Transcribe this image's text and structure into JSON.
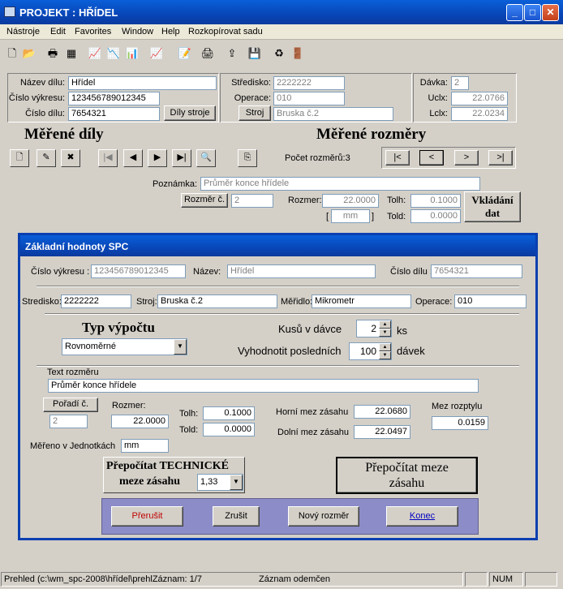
{
  "window": {
    "title": "PROJEKT : HŘÍDEL",
    "min": "_",
    "max": "□",
    "close": "✕"
  },
  "menu": [
    "Nástroje",
    "Edit",
    "Favorites",
    "Window",
    "Help",
    "Rozkopírovat sadu"
  ],
  "header": {
    "nazev_dilu_label": "Název dílu:",
    "nazev_dilu": "Hřídel",
    "cislo_vykresu_label": "Číslo výkresu:",
    "cislo_vykresu": "123456789012345",
    "cislo_dilu_label": "Číslo dílu:",
    "cislo_dilu": "7654321",
    "dily_stroje_btn": "Díly stroje",
    "stredisko_label": "Středisko:",
    "stredisko": "2222222",
    "operace_label": "Operace:",
    "operace": "010",
    "stroj_btn": "Stroj",
    "stroj": "Bruska č.2",
    "davka_label": "Dávka:",
    "davka": "2",
    "uclx_label": "Uclx:",
    "uclx": "22.0766",
    "lclx_label": "Lclx:",
    "lclx": "22.0234"
  },
  "measured_parts_title": "Měřené díly",
  "measured_dims_title": "Měřené rozměry",
  "pocet_rozmeru": "Počet rozměrů:3",
  "dim_nav": [
    "|<",
    "<",
    ">",
    ">|"
  ],
  "poznamka_label": "Poznámka:",
  "poznamka": "Průměr konce hřídele",
  "rozmer_c_btn": "Rozměr č.",
  "rozmer_c": "2",
  "rozmer_label": "Rozmer:",
  "rozmer": "22.0000",
  "unit_open": "[",
  "unit": "mm",
  "unit_close": "]",
  "tolh_label": "Tolh:",
  "tolh": "0.1000",
  "told_label": "Told:",
  "told": "0.0000",
  "vkladani_btn_1": "Vkládání",
  "vkladani_btn_2": "dat",
  "dialog": {
    "title": "Základní hodnoty  SPC",
    "cislo_vykresu_label": "Číslo výkresu :",
    "cislo_vykresu": "123456789012345",
    "nazev_label": "Název:",
    "nazev": "Hřídel",
    "cislo_dilu_label": "Číslo dílu :",
    "cislo_dilu": "7654321",
    "stredisko_label": "Stredisko:",
    "stredisko": "2222222",
    "stroj_label": "Stroj:",
    "stroj": "Bruska č.2",
    "meridlo_label": "Měřidlo:",
    "meridlo": "Mikrometr",
    "operace_label": "Operace:",
    "operace": "010",
    "typ_vypoctu_label": "Typ výpočtu",
    "typ_vypoctu": "Rovnoměrné",
    "kusu_label": "Kusů v dávce",
    "kusu": "2",
    "ks": "ks",
    "vyhodnotit_label": "Vyhodnotit posledních",
    "vyhodnotit": "100",
    "davek": "dávek",
    "text_rozmeru_label": "Text rozměru",
    "text_rozmeru": "Průměr konce hřídele",
    "poradi_btn": "Pořadí č.",
    "poradi": "2",
    "rozmer_label": "Rozmer:",
    "rozmer": "22.0000",
    "tolh_label": "Tolh:",
    "tolh": "0.1000",
    "told_label": "Told:",
    "told": "0.0000",
    "horni_label": "Horní mez zásahu",
    "horni": "22.0680",
    "dolni_label": "Dolní mez zásahu",
    "dolni": "22.0497",
    "mez_rozptylu_label": "Mez rozptylu",
    "mez_rozptylu": "0.0159",
    "mereno_label": "Měřeno v Jednotkách",
    "mereno": "mm",
    "prepocitat_tech_1": "Přepočítat TECHNICKÉ",
    "prepocitat_tech_2": "meze zásahu",
    "koef": "1,33",
    "prepocitat_meze_1": "Přepočítat meze",
    "prepocitat_meze_2": "zásahu",
    "prerusit": "Přerušit",
    "zrusit": "Zrušit",
    "novy_rozmer": "Nový rozměr",
    "konec": "Konec"
  },
  "status": {
    "path": "Prehled (c:\\wm_spc-2008\\hřídel\\prehl",
    "zaznam": "Záznam: 1/7",
    "odemcen": "Záznam odemčen",
    "num": "NUM"
  },
  "colors": {
    "accent": "#0846b8",
    "button_panel": "#8c8cc8",
    "red_text": "#c00000",
    "link": "#0000c0"
  }
}
